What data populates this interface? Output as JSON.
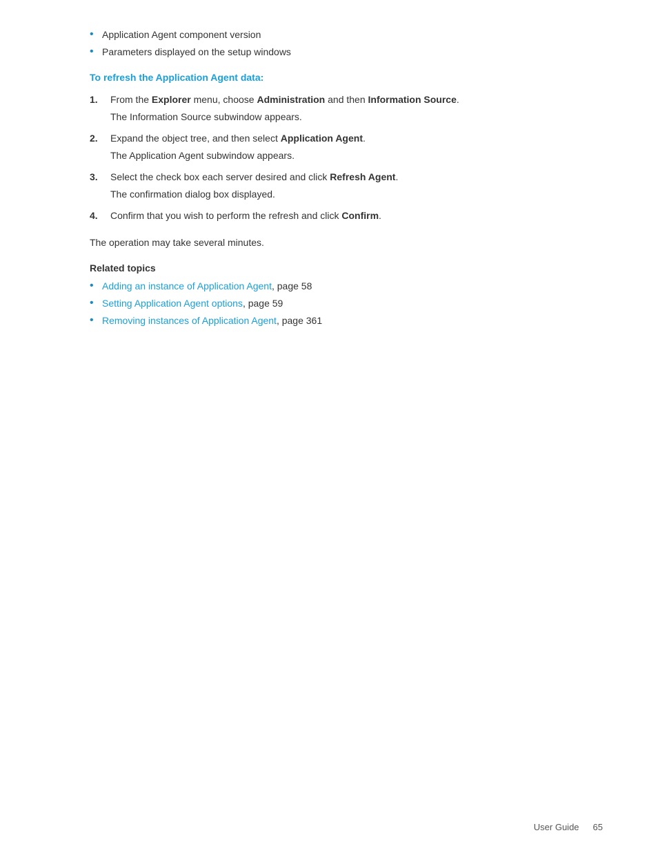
{
  "bullet_items": [
    "Application Agent component version",
    "Parameters displayed on the setup windows"
  ],
  "section_heading": "To refresh the Application Agent data:",
  "steps": [
    {
      "num": "1.",
      "main": "From the <b>Explorer</b> menu, choose <b>Administration</b> and then <b>Information Source</b>.",
      "sub": "The Information Source subwindow appears."
    },
    {
      "num": "2.",
      "main": "Expand the object tree, and then select <b>Application Agent</b>.",
      "sub": "The Application Agent subwindow appears."
    },
    {
      "num": "3.",
      "main": "Select the check box each server desired and click <b>Refresh Agent</b>.",
      "sub": "The confirmation dialog box displayed."
    },
    {
      "num": "4.",
      "main": "Confirm that you wish to perform the refresh and click <b>Confirm</b>.",
      "sub": ""
    }
  ],
  "operation_note": "The operation may take several minutes.",
  "related_topics_heading": "Related topics",
  "related_links": [
    {
      "link_text": "Adding an instance of Application Agent",
      "page_ref": ", page 58"
    },
    {
      "link_text": "Setting Application Agent options",
      "page_ref": ", page 59"
    },
    {
      "link_text": "Removing instances of Application Agent",
      "page_ref": ", page 361"
    }
  ],
  "footer": {
    "label": "User Guide",
    "page_number": "65"
  }
}
